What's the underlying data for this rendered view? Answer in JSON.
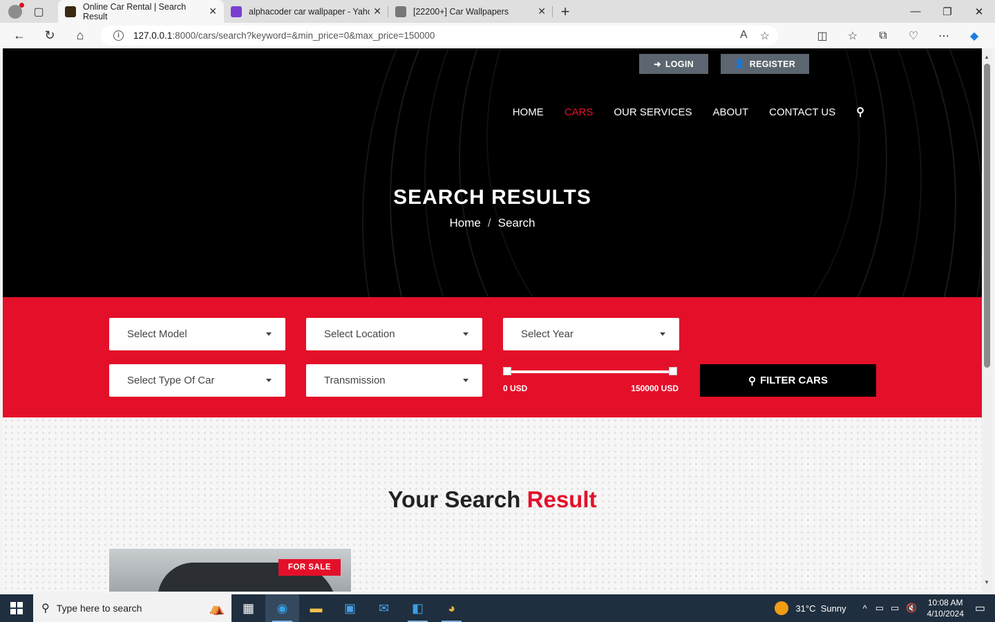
{
  "browser": {
    "tabs": [
      {
        "title": "Online Car Rental | Search Result",
        "active": true,
        "fav_color": "#3a2a12"
      },
      {
        "title": "alphacoder car wallpaper - Yahoo",
        "active": false,
        "fav_color": "#7a3fd0"
      },
      {
        "title": "[22200+] Car Wallpapers",
        "active": false,
        "fav_color": "#777777"
      }
    ],
    "url_host": "127.0.0.1",
    "url_rest": ":8000/cars/search?keyword=&min_price=0&max_price=150000"
  },
  "header": {
    "login_label": "LOGIN",
    "register_label": "REGISTER",
    "nav": [
      {
        "label": "HOME",
        "current": false
      },
      {
        "label": "CARS",
        "current": true
      },
      {
        "label": "OUR SERVICES",
        "current": false
      },
      {
        "label": "ABOUT",
        "current": false
      },
      {
        "label": "CONTACT US",
        "current": false
      }
    ],
    "title": "SEARCH RESULTS",
    "crumb_home": "Home",
    "crumb_sep": "/",
    "crumb_current": "Search"
  },
  "filter": {
    "model": "Select Model",
    "location": "Select Location",
    "year": "Select Year",
    "type": "Select Type Of Car",
    "transmission": "Transmission",
    "min_price": "0 USD",
    "max_price": "150000 USD",
    "button": "FILTER CARS"
  },
  "results": {
    "title_main": "Your Search ",
    "title_accent": "Result",
    "badge": "FOR SALE"
  },
  "taskbar": {
    "search_placeholder": "Type here to search",
    "weather": "31°C  Sunny",
    "time": "10:08 AM",
    "date": "4/10/2024"
  },
  "colors": {
    "accent": "#e4102a",
    "dark": "#000000"
  }
}
